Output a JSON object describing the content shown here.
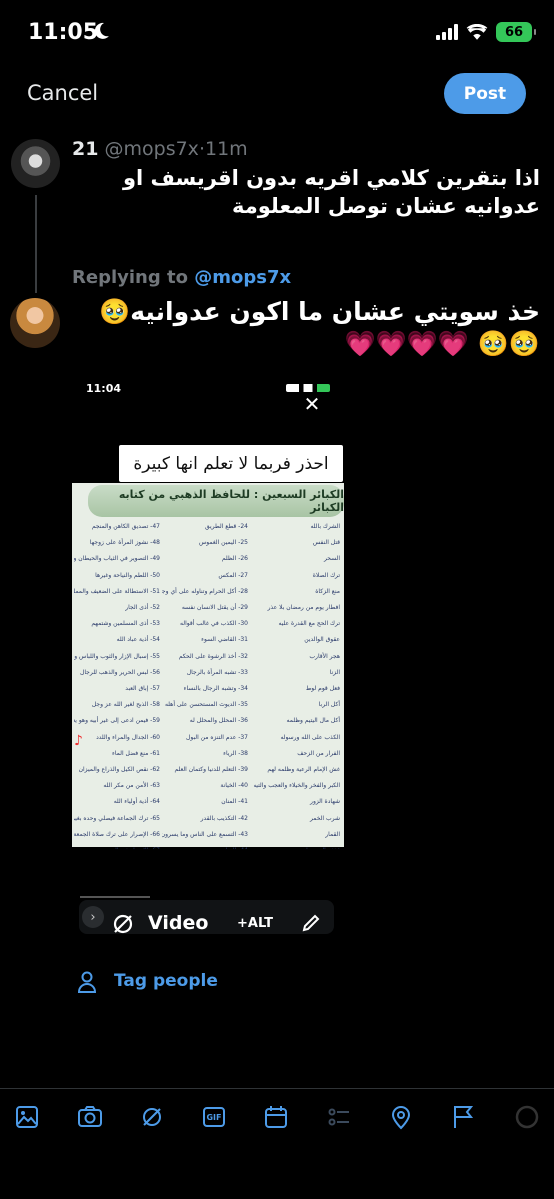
{
  "status": {
    "time": "11:05",
    "battery": "66"
  },
  "header": {
    "cancel_label": "Cancel",
    "post_label": "Post"
  },
  "original_post": {
    "display_name": "21",
    "handle": "@mops7x",
    "separator": "·",
    "time": "11m",
    "text": "اذا بتقرين كلامي اقريه بدون اقريسف او عدوانيه عشان توصل المعلومة"
  },
  "reply": {
    "prefix": "Replying to",
    "handle": "@mops7x",
    "text": "خذ سويتي عشان ما اكون عدوانيه🥹🥹🥹 💗💗💗💗"
  },
  "media": {
    "inner_time": "11:04",
    "caption": "احذر فربما لا تعلم انها كبيرة",
    "book_title": "الكبائر السبعين : للحافظ الذهبي من كتابه الكبائر",
    "columns": [
      [
        "الشرك بالله",
        "قتل النفس",
        "السحر",
        "ترك الصلاة",
        "منع الزكاة",
        "افطار يوم من رمضان بلا عذر",
        "ترك الحج مع القدرة عليه",
        "عقوق الوالدين",
        "هجر الأقارب",
        "الزنا",
        "فعل قوم لوط",
        "أكل الربا",
        "أكل مال اليتيم وظلمه",
        "الكذب على الله ورسوله",
        "الفرار من الزحف",
        "غش الإمام الرعية وظلمه لهم",
        "الكبر والفخر والخيلاء والعجب والتيه",
        "شهادة الزور",
        "شرب الخمر",
        "القمار",
        "قذف المحصنات",
        "الغلول من الغنيمة",
        "السرقة"
      ],
      [
        "24- قطع الطريق",
        "25- اليمين الغموس",
        "26- الظلم",
        "27- المكس",
        "28- أكل الحرام وتناوله على أي وجه كان",
        "29- أن يقتل الانسان نفسه",
        "30- الكذب في غالب أقواله",
        "31- القاضي السوء",
        "32- أخذ الرشوة على الحكم",
        "33- تشبه المرأة بالرجال",
        "34- وتشبه الرجال بالنساء",
        "35- الديوث المستحسن على أهله",
        "36- المحلل والمحلل له",
        "37- عدم التنزه من البول",
        "38- الرياء",
        "39- التعلم للدنيا وكتمان العلم",
        "40- الخيانة",
        "41- المنان",
        "42- التكذيب بالقدر",
        "43- التسمع على الناس وما يسرون",
        "44- النمام",
        "45- اللعان",
        "46- الغدر وعدم الوفاء بالعهد"
      ],
      [
        "47- تصديق الكاهن والمنجم",
        "48- نشوز المرأة على زوجها",
        "49- التصوير في الثياب والحيطان والحجر وغيرها",
        "50- اللطم والنياحة وغيرها",
        "51- الاستطالة على الضعيف والمملوك والزوجة والدابة",
        "52- أذى الجار",
        "53- أذى المسلمين وشتمهم",
        "54- أذية عباد الله",
        "55- إسبال الإزار والثوب واللباس والسراويل",
        "56- لبس الحرير والذهب للرجال",
        "57- إباق العبد",
        "58- الذبح لغير الله عز وجل",
        "59- فيمن ادعى إلى غير أبيه وهو يعلم",
        "60- الجدال والمراء واللدد",
        "61- منع فضل الماء",
        "62- نقص الكيل والذراع والميزان",
        "63- الأمن من مكر الله",
        "64- أذية أولياء الله",
        "65- ترك الجماعة فيصلي وحده بغير عذر",
        "66- الإصرار على ترك صلاة الجمعة والجماعة من غير عذر",
        "67- الإضرار في الوصية",
        "68- المكر والخديعة",
        "69- من جس على المسلمين ودل على عوراتهم",
        "70- سب أحد من الصحابة رضوان الله عليهم أجمعين"
      ]
    ]
  },
  "media_toolbar": {
    "video_label": "Video",
    "alt_label": "+ALT"
  },
  "tag_people_label": "Tag people",
  "colors": {
    "accent": "#4d9be8",
    "background": "#000000",
    "secondary_text": "#71767b"
  },
  "bottom_icons": [
    "image-icon",
    "camera-icon",
    "hashtag-icon",
    "gif-icon",
    "schedule-icon",
    "poll-icon",
    "location-icon",
    "flag-icon",
    "progress-circle-icon"
  ]
}
